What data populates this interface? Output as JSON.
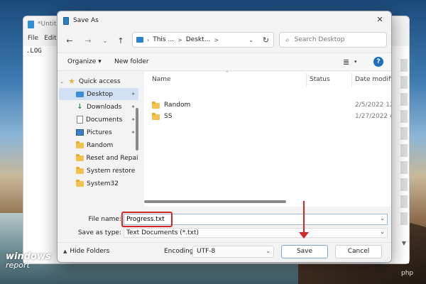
{
  "notepad": {
    "title": "*Untitle",
    "menu": [
      "File",
      "Edit"
    ],
    "content": ".LOG"
  },
  "dialog": {
    "title": "Save As",
    "close": "✕",
    "address": {
      "segments": [
        "This ...",
        "Deskt..."
      ],
      "separator": ">"
    },
    "search": {
      "placeholder": "Search Desktop"
    },
    "toolbar": {
      "organize": "Organize",
      "new_folder": "New folder",
      "help": "?"
    },
    "nav_pane": {
      "items": [
        {
          "label": "Quick access"
        },
        {
          "label": "Desktop"
        },
        {
          "label": "Downloads"
        },
        {
          "label": "Documents"
        },
        {
          "label": "Pictures"
        },
        {
          "label": "Random"
        },
        {
          "label": "Reset and Repair"
        },
        {
          "label": "System restore"
        },
        {
          "label": "System32"
        }
      ]
    },
    "file_list": {
      "columns": {
        "name": "Name",
        "status": "Status",
        "date": "Date modifie"
      },
      "rows": [
        {
          "name": "Random",
          "date": "2/5/2022 12"
        },
        {
          "name": "SS",
          "date": "1/27/2022 4"
        }
      ]
    },
    "form": {
      "file_name_label": "File name:",
      "file_name_value": "Progress.txt",
      "save_type_label": "Save as type:",
      "save_type_value": "Text Documents (*.txt)",
      "hide_folders": "Hide Folders",
      "encoding_label": "Encoding:",
      "encoding_value": "UTF-8",
      "save": "Save",
      "cancel": "Cancel"
    }
  },
  "annotation_color": "#d32626",
  "watermark": {
    "logo_line1": "windows",
    "logo_line2": "report",
    "corner": "php"
  }
}
